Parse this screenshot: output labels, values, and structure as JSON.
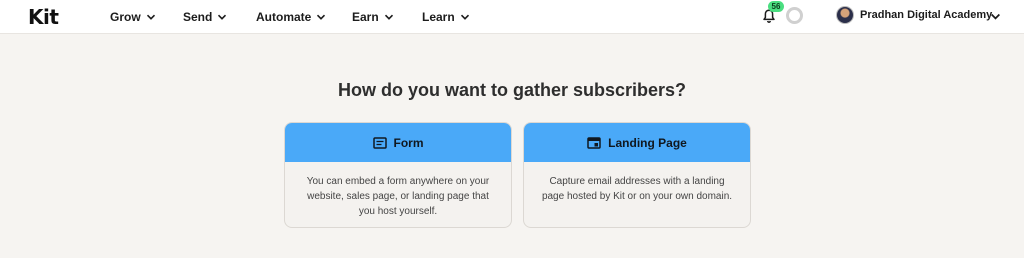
{
  "brand": {
    "logo_text": "Kit"
  },
  "nav": {
    "grow": "Grow",
    "send": "Send",
    "automate": "Automate",
    "earn": "Earn",
    "learn": "Learn"
  },
  "notifications": {
    "count": "56",
    "icon": "bell-icon"
  },
  "account": {
    "name": "Pradhan Digital Academy"
  },
  "main": {
    "headline": "How do you want to gather subscribers?",
    "options": [
      {
        "title": "Form",
        "icon": "form-icon",
        "description": "You can embed a form anywhere on your website, sales page, or landing page that you host yourself."
      },
      {
        "title": "Landing Page",
        "icon": "landing-page-icon",
        "description": "Capture email addresses with a landing page hosted by Kit or on your own domain."
      }
    ]
  },
  "colors": {
    "accent": "#4aa9f8",
    "background": "#f6f4f1",
    "badge": "#4ade80"
  }
}
